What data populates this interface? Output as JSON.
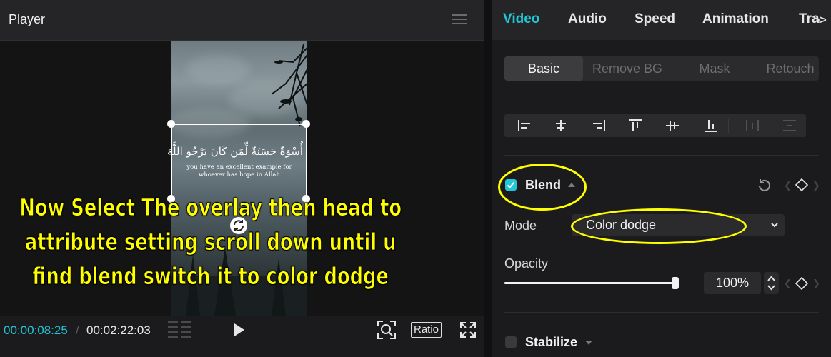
{
  "player": {
    "title": "Player",
    "arabic_text": "أُسْوَةٌ حَسَنَةٌ لِّمَن كَانَ يَرْجُو اللَّهَ",
    "translation_line1": "you have an excellent example for",
    "translation_line2": "whoever has hope in Allah",
    "caption_line1": "Now Select The overlay then head to",
    "caption_line2": "attribute setting scroll down until u",
    "caption_line3": "find blend switch it to color dodge",
    "current_time": "00:00:08:25",
    "separator": "/",
    "total_time": "00:02:22:03",
    "ratio_label": "Ratio"
  },
  "inspector": {
    "tabs": [
      {
        "label": "Video"
      },
      {
        "label": "Audio"
      },
      {
        "label": "Speed"
      },
      {
        "label": "Animation"
      },
      {
        "label": "Tra"
      }
    ],
    "more_arrow": ">>",
    "subtabs": [
      {
        "label": "Basic"
      },
      {
        "label": "Remove BG"
      },
      {
        "label": "Mask"
      },
      {
        "label": "Retouch"
      }
    ],
    "blend": {
      "label": "Blend",
      "checked": true
    },
    "mode": {
      "label": "Mode",
      "value": "Color dodge"
    },
    "opacity": {
      "label": "Opacity",
      "value": "100%",
      "level": 1.0
    },
    "stabilize": {
      "label": "Stabilize",
      "checked": false
    }
  },
  "colors": {
    "accent": "#22c6d6",
    "annotation": "#ffff00"
  }
}
